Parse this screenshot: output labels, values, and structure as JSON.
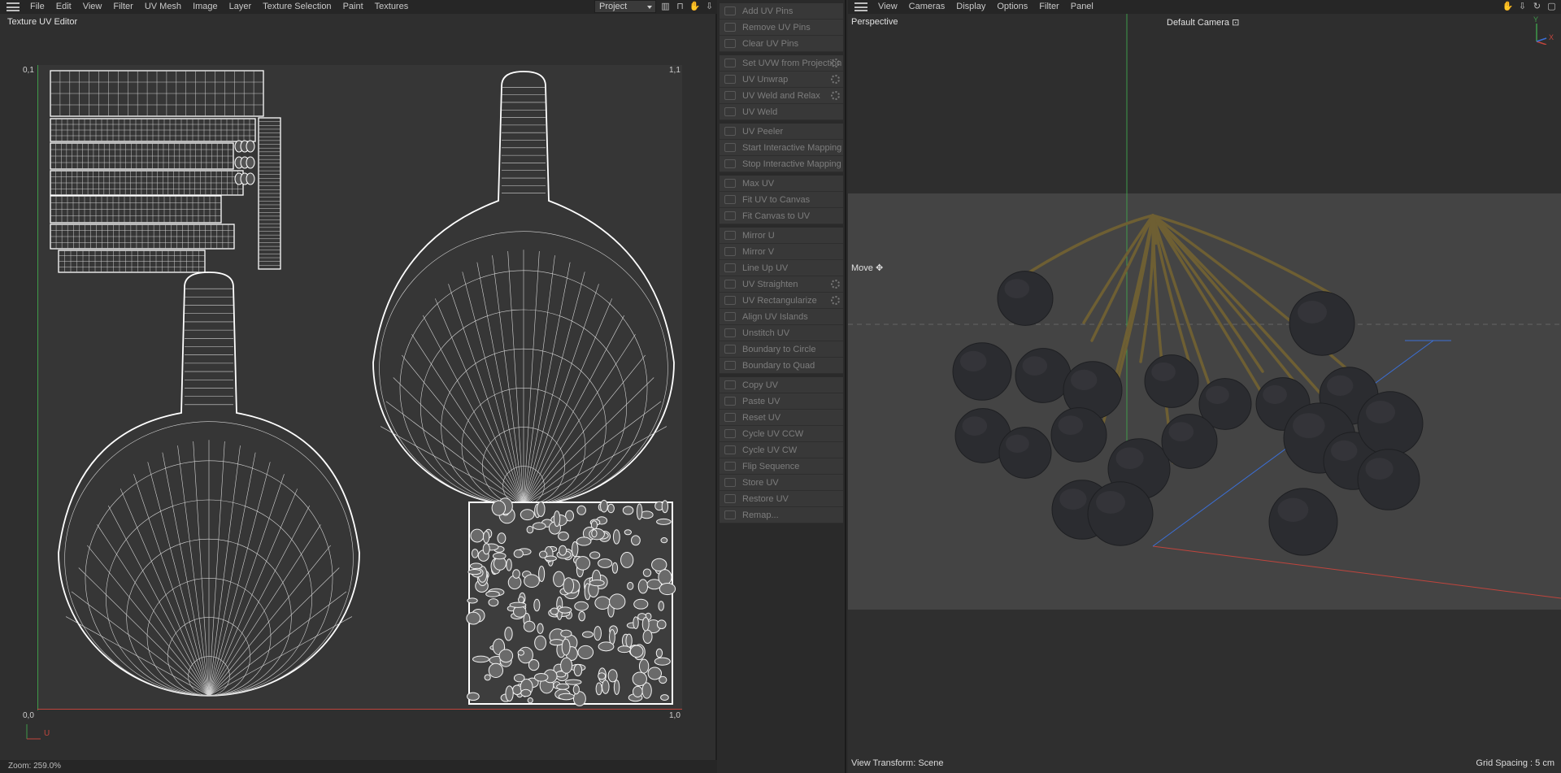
{
  "uv_editor": {
    "menu": [
      "File",
      "Edit",
      "View",
      "Filter",
      "UV Mesh",
      "Image",
      "Layer",
      "Texture Selection",
      "Paint",
      "Textures"
    ],
    "project_select": "Project",
    "title": "Texture UV Editor",
    "corner_labels": {
      "top_left": "0,1",
      "top_right": "1,1",
      "bottom_left": "0,0",
      "bottom_right": "1,0"
    },
    "gizmo_label": "U",
    "zoom": "Zoom: 259.0%"
  },
  "commands": [
    [
      "Add UV Pins",
      "Remove UV Pins",
      "Clear UV Pins"
    ],
    [
      "Set UVW from Projection",
      "UV Unwrap",
      "UV Weld and Relax",
      "UV Weld"
    ],
    [
      "UV Peeler",
      "Start Interactive Mapping",
      "Stop Interactive Mapping"
    ],
    [
      "Max UV",
      "Fit UV to Canvas",
      "Fit Canvas to UV"
    ],
    [
      "Mirror U",
      "Mirror V",
      "Line Up UV",
      "UV Straighten",
      "UV Rectangularize",
      "Align UV Islands",
      "Unstitch UV",
      "Boundary to Circle",
      "Boundary to Quad"
    ],
    [
      "Copy UV",
      "Paste UV",
      "Reset UV",
      "Cycle UV CCW",
      "Cycle UV CW",
      "Flip Sequence",
      "Store UV",
      "Restore UV",
      "Remap..."
    ]
  ],
  "commands_with_settings": [
    "Set UVW from Projection",
    "UV Unwrap",
    "UV Weld and Relax",
    "UV Straighten",
    "UV Rectangularize"
  ],
  "viewport": {
    "menu": [
      "View",
      "Cameras",
      "Display",
      "Options",
      "Filter",
      "Panel"
    ],
    "projection": "Perspective",
    "camera": "Default Camera",
    "tool": "Move",
    "view_transform": "View Transform: Scene",
    "grid_spacing": "Grid Spacing : 5 cm",
    "axis_labels": {
      "y": "Y",
      "x": "X"
    }
  },
  "colors": {
    "axis_u": "#c0453d",
    "axis_v": "#3f9a4a",
    "grid_blue": "#3b6fd6",
    "berry": "#2b2c30",
    "stem": "#6e5f33"
  }
}
